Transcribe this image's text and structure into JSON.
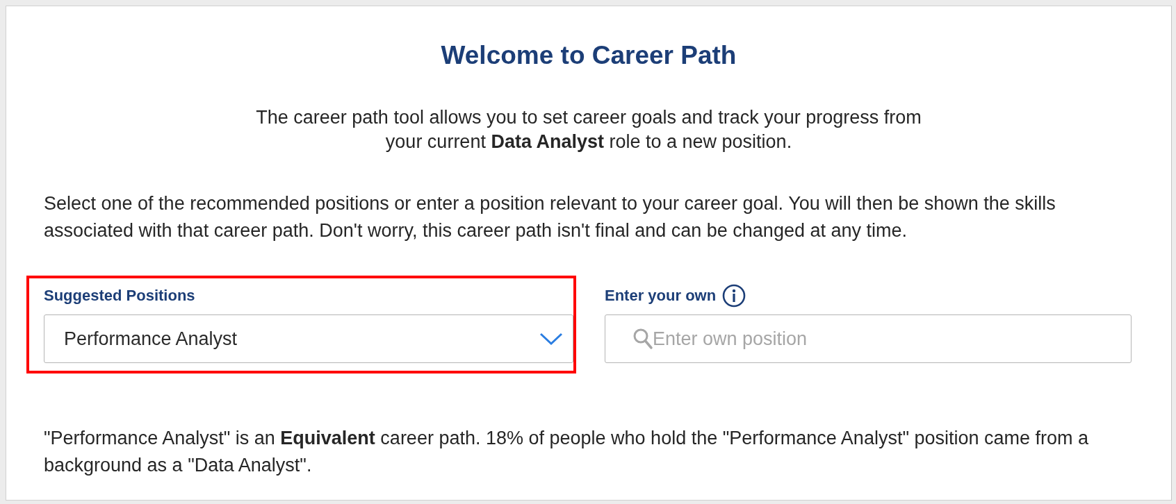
{
  "title": "Welcome to Career Path",
  "intro_lines": [
    "The career path tool allows you to set career goals and track your progress from",
    "your current **Data Analyst** role to a new position."
  ],
  "instructions": "Select one of the recommended positions or enter a position relevant to your career goal. You will then be shown the skills associated with that career path. Don't worry, this career path isn't final and can be changed at any time.",
  "suggested": {
    "label": "Suggested Positions",
    "value": "Performance Analyst",
    "highlighted": true
  },
  "own": {
    "label": "Enter your own",
    "placeholder": "Enter own position"
  },
  "result": "\"Performance Analyst\" is an **Equivalent** career path. 18% of people who hold the \"Performance Analyst\" position came from a background as a \"Data Analyst\"."
}
